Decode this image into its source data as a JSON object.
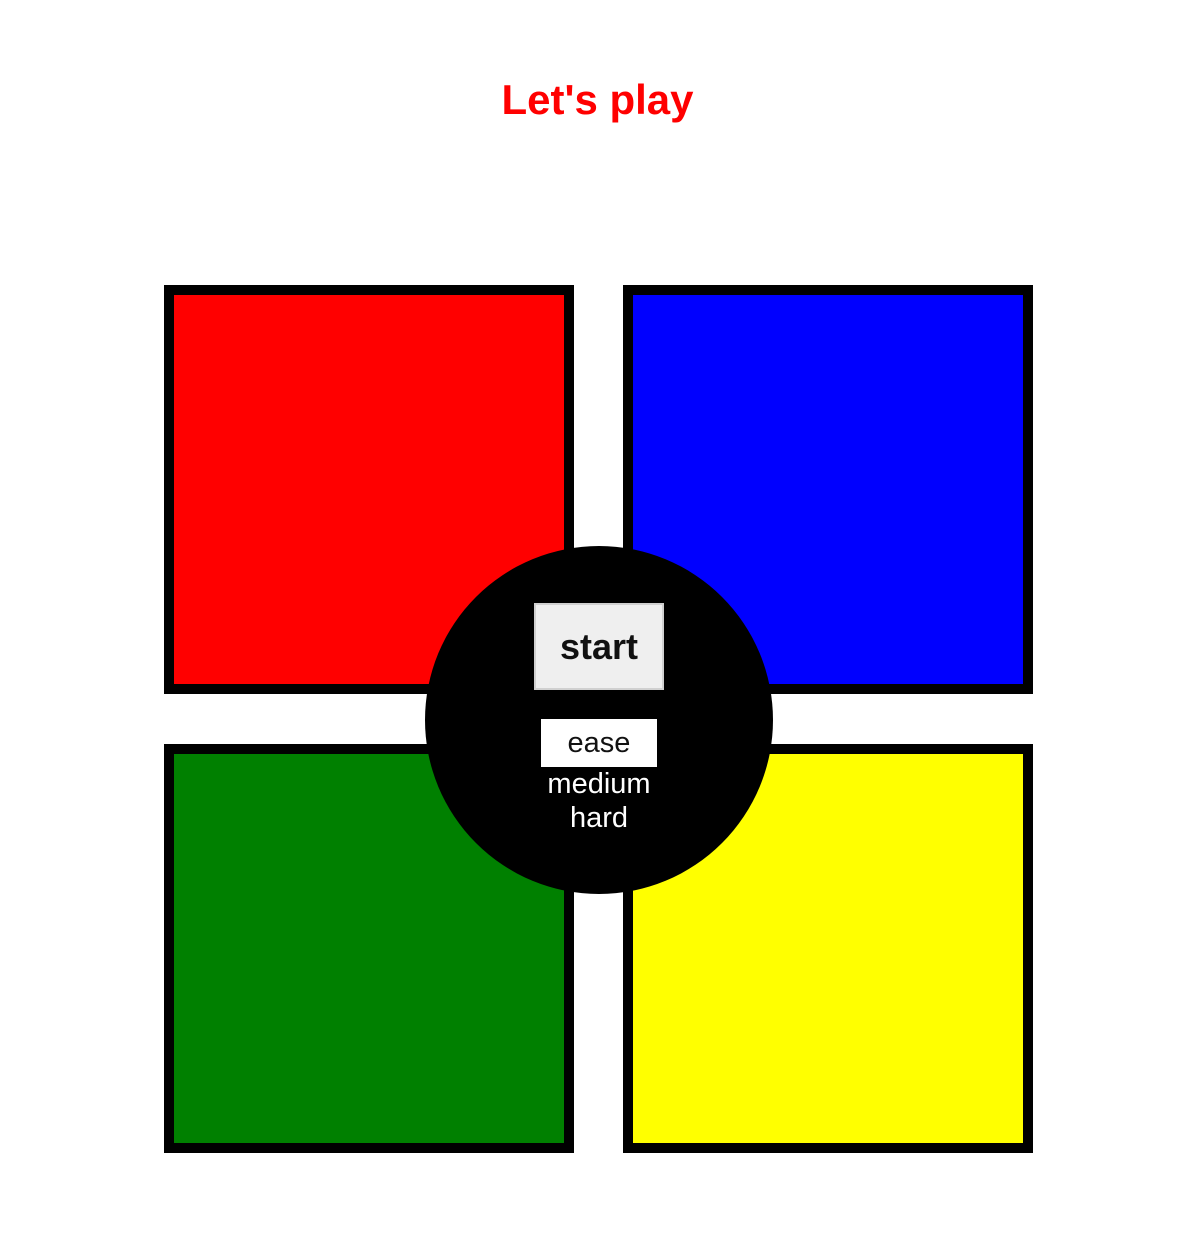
{
  "title": "Let's play",
  "pads": [
    {
      "id": "red",
      "color": "#ff0000"
    },
    {
      "id": "blue",
      "color": "#0000ff"
    },
    {
      "id": "green",
      "color": "#008000"
    },
    {
      "id": "yellow",
      "color": "#ffff00"
    }
  ],
  "controls": {
    "start_label": "start",
    "difficulty": {
      "options": [
        "ease",
        "medium",
        "hard"
      ],
      "selected": "ease"
    }
  },
  "colors": {
    "title": "#ff0000",
    "border": "#000000",
    "center": "#000000"
  }
}
